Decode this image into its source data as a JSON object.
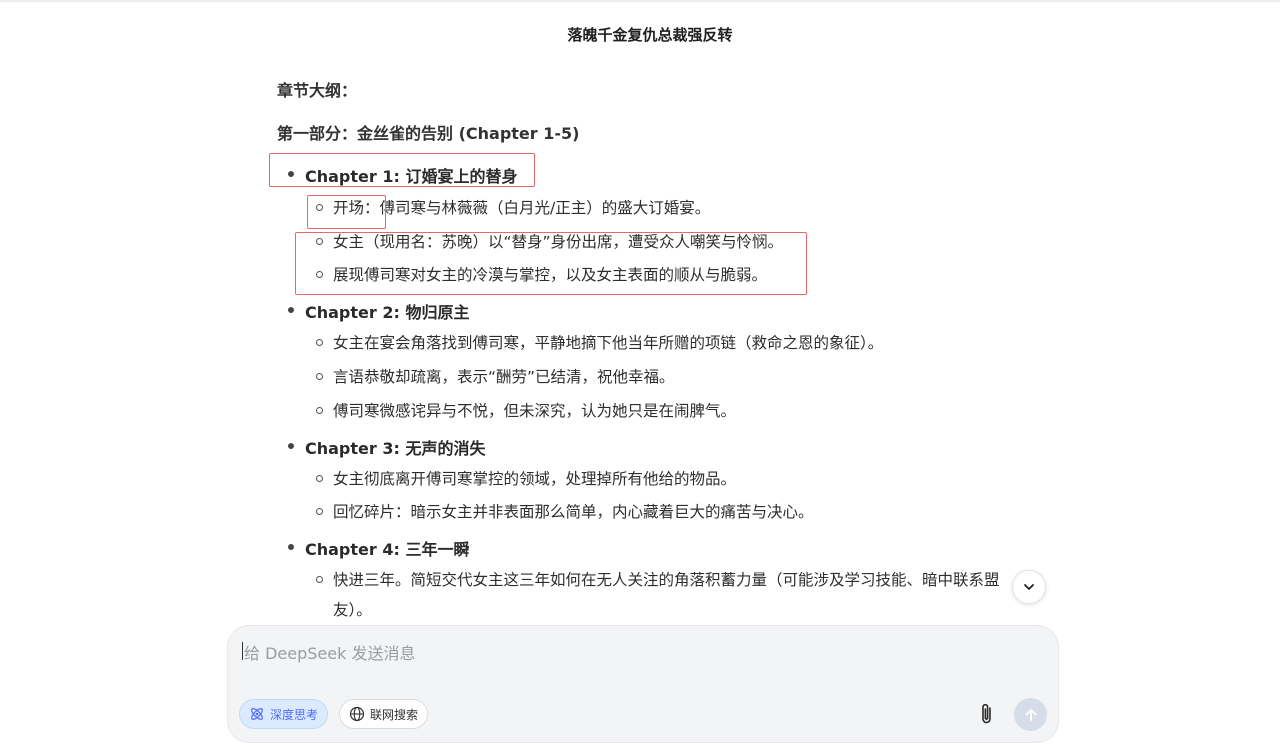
{
  "page_title": "落魄千金复仇总裁强反转",
  "outline_heading": "章节大纲：",
  "part_heading": "第一部分：金丝雀的告别 (Chapter 1-5)",
  "chapters": [
    {
      "title": "Chapter 1: 订婚宴上的替身",
      "items": [
        "开场：傅司寒与林薇薇（白月光/正主）的盛大订婚宴。",
        "女主（现用名：苏晚）以“替身”身份出席，遭受众人嘲笑与怜悯。",
        "展现傅司寒对女主的冷漠与掌控，以及女主表面的顺从与脆弱。"
      ]
    },
    {
      "title": "Chapter 2: 物归原主",
      "items": [
        "女主在宴会角落找到傅司寒，平静地摘下他当年所赠的项链（救命之恩的象征）。",
        "言语恭敬却疏离，表示“酬劳”已结清，祝他幸福。",
        "傅司寒微感诧异与不悦，但未深究，认为她只是在闹脾气。"
      ]
    },
    {
      "title": "Chapter 3: 无声的消失",
      "items": [
        "女主彻底离开傅司寒掌控的领域，处理掉所有他给的物品。",
        "回忆碎片：暗示女主并非表面那么简单，内心藏着巨大的痛苦与决心。"
      ]
    },
    {
      "title": "Chapter 4: 三年一瞬",
      "items": [
        "快进三年。简短交代女主这三年如何在无人关注的角落积蓄力量（可能涉及学习技能、暗中联系盟",
        "友）。"
      ]
    }
  ],
  "composer": {
    "placeholder": "给 DeepSeek 发送消息",
    "deep_think_label": "深度思考",
    "web_search_label": "联网搜索"
  },
  "icons": {
    "scroll_down": "chevron-down-icon",
    "deep_think": "atom-icon",
    "web_search": "globe-icon",
    "attach": "paperclip-icon",
    "send": "arrow-up-icon"
  },
  "colors": {
    "accent": "#4d6bfe",
    "annotation_box": "#e8676a",
    "send_disabled": "#d6dde8"
  }
}
